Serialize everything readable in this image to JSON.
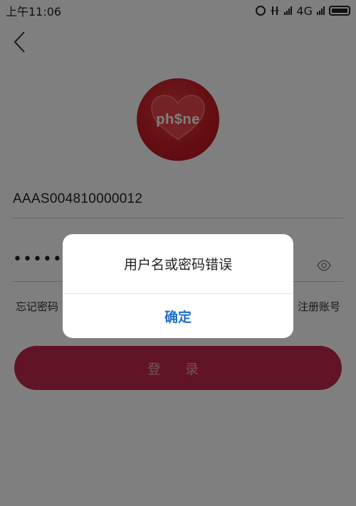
{
  "status_bar": {
    "time": "上午11:06",
    "network": "4G",
    "icons": [
      "alarm-icon",
      "vibrate-icon",
      "signal-icon",
      "signal-icon",
      "battery-icon"
    ]
  },
  "header": {
    "back_icon": "back-arrow-icon"
  },
  "logo": {
    "text": "ph$ne",
    "icon": "heart-icon"
  },
  "login_form": {
    "username_value": "AAAS004810000012",
    "password_masked": "••••••",
    "eye_icon": "eye-icon",
    "forgot_password": "忘记密码",
    "register_account": "注册账号",
    "login_button": "登 录"
  },
  "dialog": {
    "message": "用户名或密码错误",
    "confirm_button": "确定"
  },
  "colors": {
    "brand_red": "#c0294a",
    "dialog_button": "#1d6fd1",
    "overlay": "rgba(0,0,0,0.5)"
  }
}
